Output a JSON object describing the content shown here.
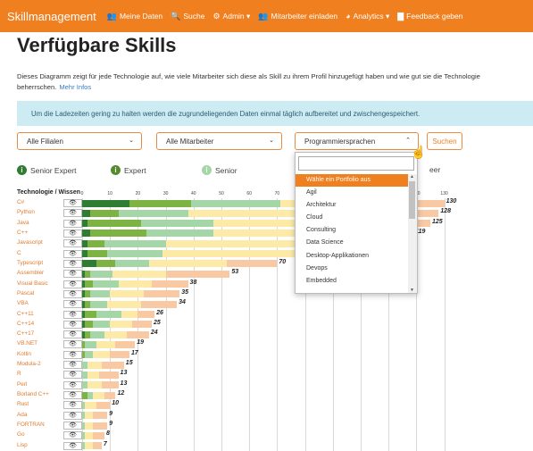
{
  "nav": {
    "brand": "Skillmanagement",
    "items": [
      {
        "label": "Meine Daten",
        "icon": "users-icon"
      },
      {
        "label": "Suche",
        "icon": "search-icon"
      },
      {
        "label": "Admin ▾",
        "icon": "gear-icon"
      },
      {
        "label": "Mitarbeiter einladen",
        "icon": "user-plus-icon"
      },
      {
        "label": "Analytics ▾",
        "icon": "chart-icon"
      },
      {
        "label": "Feedback geben",
        "icon": "comment-icon"
      }
    ]
  },
  "page": {
    "title": "Verfügbare Skills",
    "description": "Dieses Diagramm zeigt für jede Technologie auf, wie viele Mitarbeiter sich diese als Skill zu ihrem Profil hinzugefügt haben und wie gut sie die Technologie",
    "description2": "beherrschen.",
    "more_link": "Mehr Infos",
    "alert": "Um die Ladezeiten gering zu halten werden die zugrundeliegenden Daten einmal täglich aufbereitet und zwischengespeichert."
  },
  "filters": {
    "branch": "Alle Filialen",
    "employees": "Alle Mitarbeiter",
    "category": "Programmiersprachen",
    "search_button": "Suchen"
  },
  "legend": {
    "items": [
      "Senior Expert",
      "Expert",
      "Senior",
      "eer"
    ],
    "colors": {
      "senior_expert": "#2e7d32",
      "expert": "#7cb342",
      "senior": "#a5d6a7",
      "junior": "#fdeaa7",
      "beginner": "#f9c9a4"
    }
  },
  "table": {
    "header": "Technologie / Wissen",
    "eye_icon": "👁"
  },
  "chart_data": {
    "type": "bar",
    "stacked": true,
    "orientation": "horizontal",
    "x_ticks": [
      0,
      10,
      20,
      30,
      40,
      50,
      60,
      70,
      80,
      90,
      100,
      110,
      120,
      130
    ],
    "xlim": [
      0,
      130
    ],
    "categories": [
      "C#",
      "Python",
      "Java",
      "C++",
      "Javascript",
      "C",
      "Typescript",
      "Assembler",
      "Visual Basic",
      "Pascal",
      "VBA",
      "C++11",
      "C++14",
      "C++17",
      "VB.NET",
      "Kotlin",
      "Modula-2",
      "R",
      "Perl",
      "Borland C++",
      "Rust",
      "Ada",
      "FORTRAN",
      "Go",
      "Lisp"
    ],
    "totals": [
      130,
      128,
      125,
      119,
      null,
      null,
      70,
      53,
      38,
      35,
      34,
      26,
      25,
      24,
      19,
      17,
      15,
      13,
      13,
      12,
      10,
      9,
      9,
      8,
      7
    ],
    "series": [
      {
        "name": "Senior Expert",
        "values": [
          17,
          3,
          2,
          3,
          2,
          2,
          5,
          1,
          1,
          1,
          1,
          1,
          1,
          1,
          0,
          0,
          0,
          0,
          0,
          0,
          0,
          0,
          0,
          0,
          0
        ]
      },
      {
        "name": "Expert",
        "values": [
          22,
          10,
          19,
          20,
          6,
          7,
          7,
          2,
          3,
          2,
          2,
          4,
          3,
          2,
          1,
          1,
          0,
          0,
          0,
          2,
          0,
          0,
          0,
          0,
          0
        ]
      },
      {
        "name": "Senior",
        "values": [
          32,
          25,
          26,
          24,
          22,
          20,
          12,
          8,
          9,
          7,
          6,
          9,
          6,
          5,
          4,
          3,
          2,
          2,
          2,
          2,
          1,
          1,
          1,
          1,
          1
        ]
      },
      {
        "name": "Junior",
        "values": [
          36,
          46,
          40,
          40,
          50,
          48,
          28,
          19,
          12,
          12,
          12,
          6,
          8,
          8,
          7,
          6,
          5,
          4,
          5,
          4,
          4,
          3,
          3,
          3,
          3
        ]
      },
      {
        "name": "Beginner",
        "values": [
          23,
          44,
          38,
          32,
          40,
          43,
          18,
          23,
          13,
          13,
          13,
          6,
          7,
          8,
          7,
          7,
          8,
          7,
          6,
          4,
          5,
          5,
          5,
          4,
          3
        ]
      }
    ]
  },
  "dropdown": {
    "options": [
      "Wähle ein Portfolio aus",
      "Agil",
      "Architektur",
      "Cloud",
      "Consulting",
      "Data Science",
      "Desktop-Applikationen",
      "Devops",
      "Embedded"
    ],
    "active_index": 0
  }
}
